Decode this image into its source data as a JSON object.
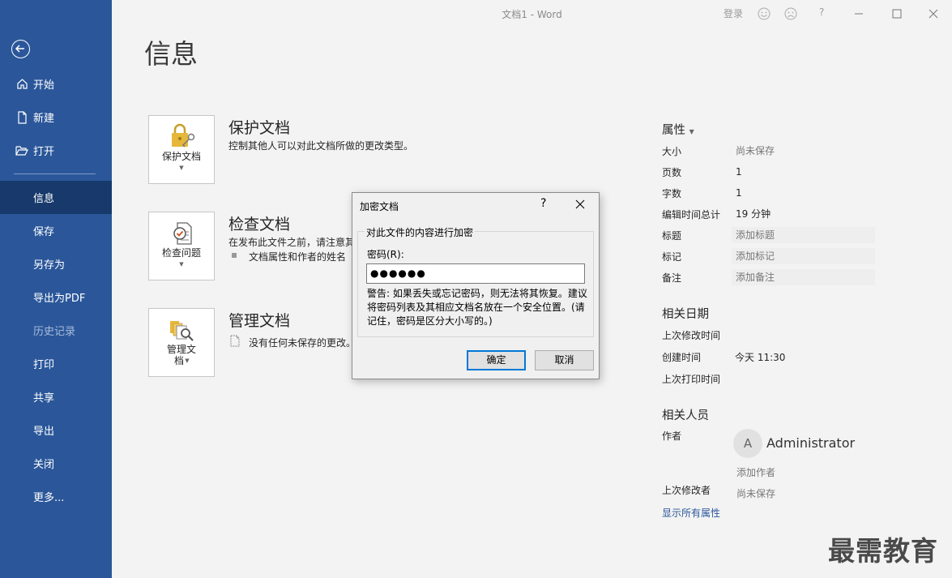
{
  "window": {
    "title": "文档1  -  Word",
    "sign_in": "登录",
    "help": "?"
  },
  "sidebar": {
    "items": [
      {
        "label": "开始",
        "icon": "home-icon"
      },
      {
        "label": "新建",
        "icon": "new-document-icon"
      },
      {
        "label": "打开",
        "icon": "open-folder-icon"
      },
      {
        "label": "信息",
        "active": true
      },
      {
        "label": "保存"
      },
      {
        "label": "另存为"
      },
      {
        "label": "导出为PDF"
      },
      {
        "label": "历史记录",
        "disabled": true
      },
      {
        "label": "打印"
      },
      {
        "label": "共享"
      },
      {
        "label": "导出"
      },
      {
        "label": "关闭"
      },
      {
        "label": "更多..."
      }
    ],
    "colors": {
      "background": "#2b579a",
      "active": "#17396b"
    }
  },
  "main": {
    "title": "信息",
    "sections": [
      {
        "button_label": "保护文档",
        "title": "保护文档",
        "desc": "控制其他人可以对此文档所做的更改类型。"
      },
      {
        "button_label": "检查问题",
        "title": "检查文档",
        "desc": "在发布此文件之前，请注意其",
        "bullet": "文档属性和作者的姓名"
      },
      {
        "button_label_line1": "管理文",
        "button_label_line2": "档",
        "title": "管理文档",
        "desc": "没有任何未保存的更改。"
      }
    ]
  },
  "properties": {
    "heading": "属性",
    "rows": [
      {
        "label": "大小",
        "value": "尚未保存"
      },
      {
        "label": "页数",
        "value": "1"
      },
      {
        "label": "字数",
        "value": "1"
      },
      {
        "label": "编辑时间总计",
        "value": "19 分钟"
      },
      {
        "label": "标题",
        "value": "添加标题"
      },
      {
        "label": "标记",
        "value": "添加标记"
      },
      {
        "label": "备注",
        "value": "添加备注"
      }
    ],
    "dates": {
      "heading": "相关日期",
      "last_modified": "上次修改时间",
      "created": "创建时间",
      "created_value": "今天 11:30",
      "last_printed": "上次打印时间"
    },
    "people": {
      "heading": "相关人员",
      "author_label": "作者",
      "avatar_initial": "A",
      "author_name": "Administrator",
      "add_author": "添加作者",
      "last_modified_by_label": "上次修改者",
      "last_modified_by_value": "尚未保存"
    },
    "show_all": "显示所有属性"
  },
  "dialog": {
    "title": "加密文档",
    "help": "?",
    "legend": "对此文件的内容进行加密",
    "password_label": "密码(R):",
    "password_value": "●●●●●●",
    "warning": "警告: 如果丢失或忘记密码，则无法将其恢复。建议将密码列表及其相应文档名放在一个安全位置。(请记住，密码是区分大小写的。)",
    "ok": "确定",
    "cancel": "取消"
  },
  "watermark": "最需教育"
}
